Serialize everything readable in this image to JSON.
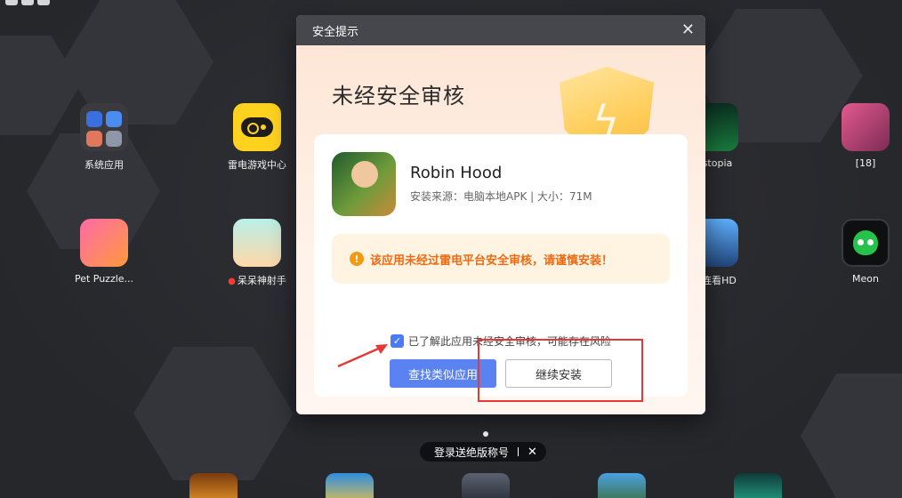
{
  "desktop": {
    "apps": [
      {
        "label": "系统应用"
      },
      {
        "label": "雷电游戏中心"
      },
      {
        "label": "dstopia"
      },
      {
        "label": "[18]"
      },
      {
        "label": "Pet Puzzle..."
      },
      {
        "label": "呆呆神射手"
      },
      {
        "label": "连连看HD"
      },
      {
        "label": "Meon"
      }
    ],
    "promo": {
      "text": "登录送绝版称号",
      "sep": "|",
      "close": "✕"
    }
  },
  "dialog": {
    "title": "安全提示",
    "close": "✕",
    "heading": "未经安全审核",
    "app_name": "Robin Hood",
    "app_meta": "安装来源：电脑本地APK | 大小：71M",
    "warning_icon": "!",
    "warning_text": "该应用未经过雷电平台安全审核，请谨慎安装！",
    "checkbox_mark": "✓",
    "agree_text": "已了解此应用未经安全审核，可能存在风险",
    "btn_find": "查找类似应用",
    "btn_continue": "继续安装",
    "shield_glyph": "ϟ"
  },
  "colors": {
    "accent": "#5a82f0",
    "warning": "#ee6a12",
    "annotation": "#e53935"
  },
  "icons": [
    "close-icon",
    "warning-icon",
    "checkbox-checked-icon",
    "shield-icon",
    "gamepad-icon"
  ]
}
